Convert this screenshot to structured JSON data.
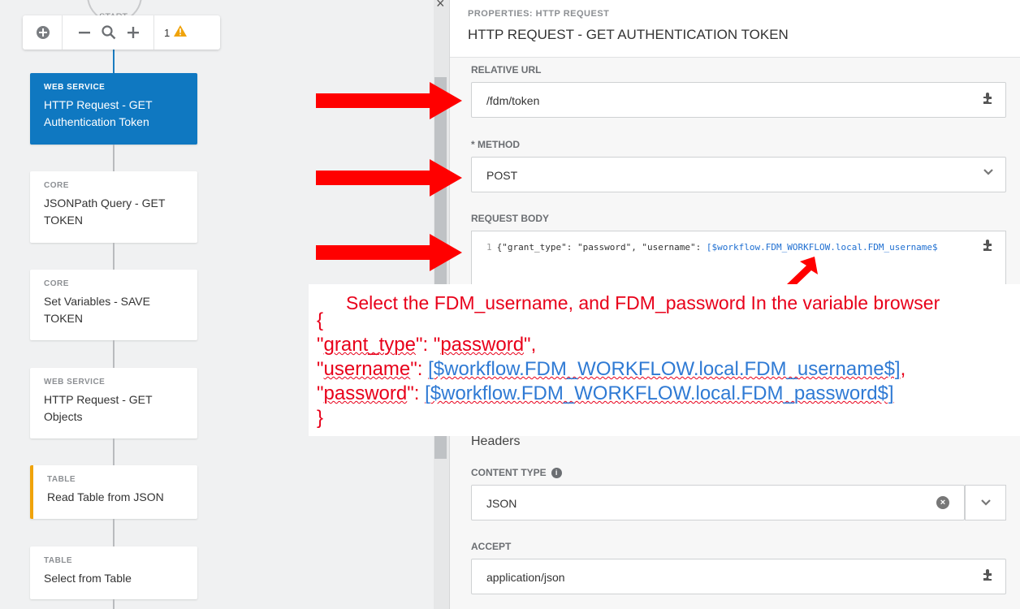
{
  "canvas": {
    "start_label": "START",
    "toolbar": {
      "warning_count": "1"
    },
    "nodes": [
      {
        "type": "WEB SERVICE",
        "title": "HTTP Request - GET Authentication Token"
      },
      {
        "type": "CORE",
        "title": "JSONPath Query - GET TOKEN"
      },
      {
        "type": "CORE",
        "title": "Set Variables - SAVE TOKEN"
      },
      {
        "type": "WEB SERVICE",
        "title": "HTTP Request - GET Objects"
      },
      {
        "type": "TABLE",
        "title": "Read Table from JSON"
      },
      {
        "type": "TABLE",
        "title": "Select from Table"
      }
    ]
  },
  "panel": {
    "subtitle": "PROPERTIES: HTTP REQUEST",
    "title": "HTTP REQUEST - GET AUTHENTICATION TOKEN",
    "relative_url": {
      "label": "RELATIVE URL",
      "value": "/fdm/token"
    },
    "method": {
      "label": "* METHOD",
      "value": "POST"
    },
    "request_body": {
      "label": "REQUEST BODY",
      "line_number": "1",
      "code_text": "{\"grant_type\": \"password\", \"username\": ",
      "code_var": "[$workflow.FDM_WORKFLOW.local.FDM_username$"
    },
    "headers_title": "Headers",
    "content_type": {
      "label": "CONTENT TYPE",
      "value": "JSON"
    },
    "accept": {
      "label": "ACCEPT",
      "value": "application/json"
    }
  },
  "annotation": {
    "heading_pre": "Select the ",
    "heading_u1": "FDM_username",
    "heading_mid": ", and ",
    "heading_u2": "FDM_password",
    "heading_post": " In the variable browser",
    "open_brace": "{",
    "l1_q1": "\"",
    "l1_key": "grant_type",
    "l1_rest": "\": \"",
    "l1_val": "password",
    "l1_end": "\",",
    "l2_q1": "\"",
    "l2_key": "username",
    "l2_rest": "\": ",
    "l2_val": "[$workflow.FDM_WORKFLOW.local.FDM_username$]",
    "l2_end": ",",
    "l3_q1": "\"",
    "l3_key": "password",
    "l3_rest": "\": ",
    "l3_val": "[$workflow.FDM_WORKFLOW.local.FDM_password$]",
    "close_brace": "}"
  },
  "colors": {
    "accent": "#0f78c1",
    "warning": "#f0a30a",
    "annotation_red": "#e8001a",
    "annotation_blue": "#2f7ad4"
  }
}
